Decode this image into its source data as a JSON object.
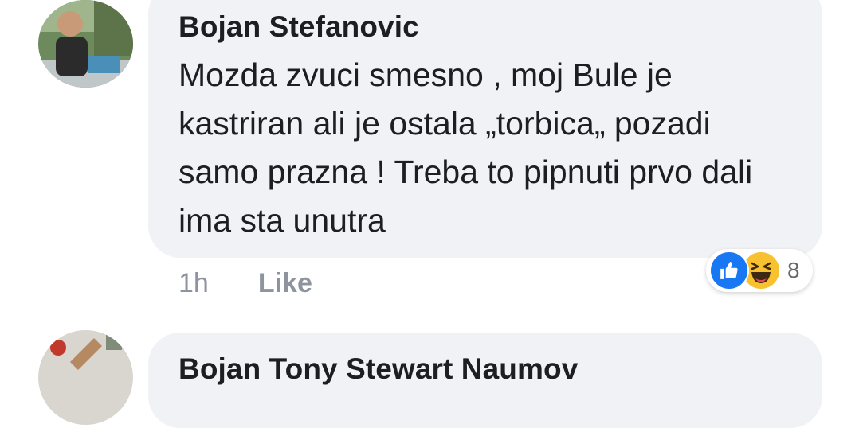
{
  "comments": [
    {
      "author": "Bojan Stefanovic",
      "text": "Mozda zvuci smesno , moj Bule je kastriran ali je ostala „torbica„ pozadi samo prazna ! Treba to pipnuti prvo dali ima sta unutra",
      "time": "1h",
      "like_label": "Like",
      "reactions": {
        "icons": [
          "like-icon",
          "haha-icon"
        ],
        "count": "8"
      }
    },
    {
      "author": "Bojan Tony Stewart Naumov"
    }
  ],
  "colors": {
    "bubble_bg": "#f0f2f5",
    "text": "#1c1e21",
    "muted": "#8d949e",
    "like_blue": "#1877f2",
    "haha_yellow": "#f7c12f"
  }
}
